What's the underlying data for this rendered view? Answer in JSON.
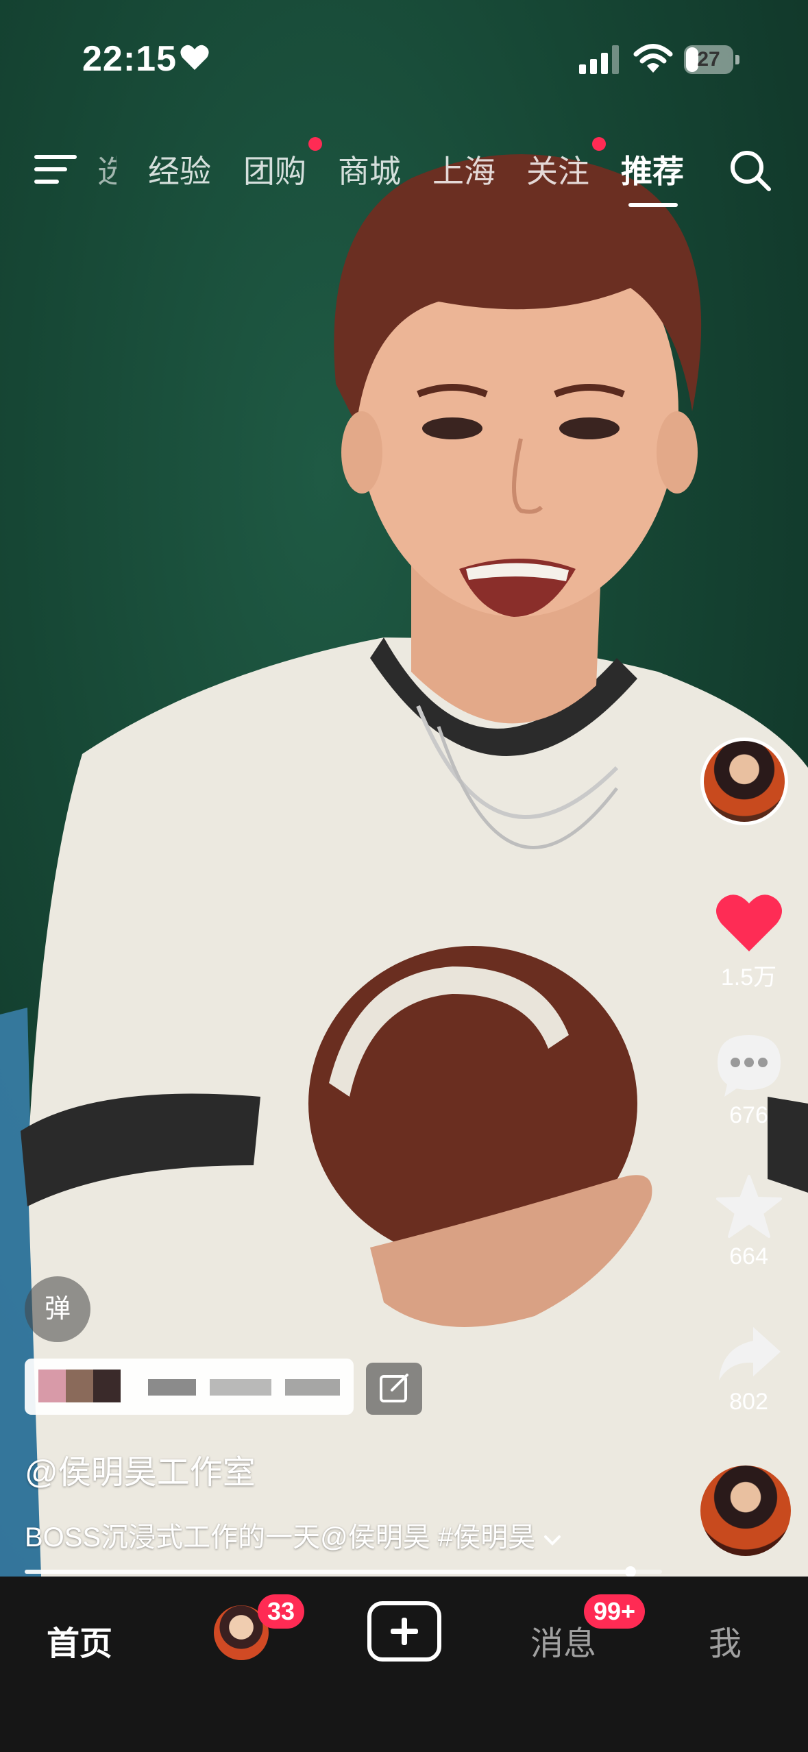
{
  "status_bar": {
    "time": "22:15",
    "battery": "27",
    "battery_level": 0.27
  },
  "top_nav": {
    "partial_tab": "选",
    "tabs": [
      {
        "label": "经验",
        "dot": false
      },
      {
        "label": "团购",
        "dot": true
      },
      {
        "label": "商城",
        "dot": false
      },
      {
        "label": "上海",
        "dot": false
      },
      {
        "label": "关注",
        "dot": true
      },
      {
        "label": "推荐",
        "dot": false,
        "active": true
      }
    ]
  },
  "actions": {
    "likes": "1.5万",
    "comments": "676",
    "favorites": "664",
    "shares": "802"
  },
  "danmu_label": "弹",
  "video_info": {
    "author": "@侯明昊工作室",
    "caption": "BOSS沉浸式工作的一天@侯明昊 #侯明昊",
    "progress": 0.95
  },
  "bottom_tabs": {
    "home": "首页",
    "friends_badge": "33",
    "messages": "消息",
    "messages_badge": "99+",
    "me": "我"
  },
  "colors": {
    "accent_red": "#ff2b54",
    "like_red": "#fe2c55",
    "tabbar_bg": "#161616"
  }
}
